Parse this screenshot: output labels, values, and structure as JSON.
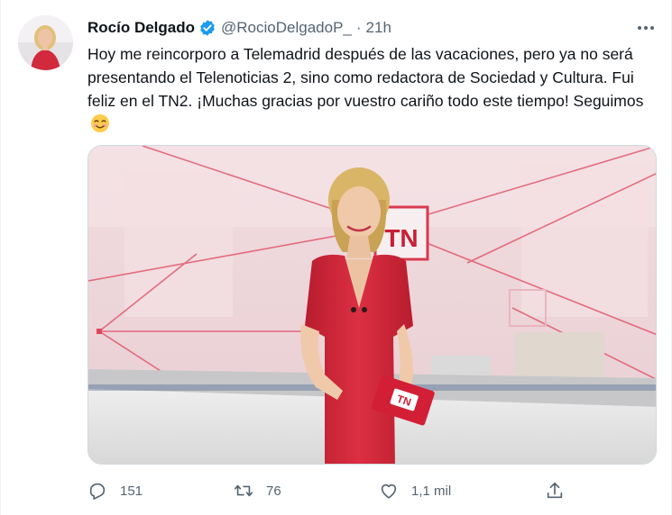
{
  "author": {
    "display_name": "Rocío Delgado",
    "handle": "@RocioDelgadoP_",
    "separator": "·",
    "time": "21h",
    "verified": true
  },
  "tweet": {
    "text": "Hoy me reincorporo a Telemadrid después de las vacaciones, pero ya no será presentando el Telenoticias 2, sino como redactora de Sociedad y Cultura. Fui feliz en el TN2. ¡Muchas gracias por vuestro cariño todo este tiempo! Seguimos",
    "emoji": "smiling-face-with-smiling-eyes"
  },
  "media": {
    "set_logo_text": "TN",
    "booklet_logo_text": "TN"
  },
  "actions": {
    "replies": "151",
    "retweets": "76",
    "likes": "1,1 mil"
  },
  "colors": {
    "verified_blue": "#1d9bf0",
    "muted_text": "#536471",
    "dress_red": "#d6283a",
    "set_pink": "#efd6da"
  }
}
